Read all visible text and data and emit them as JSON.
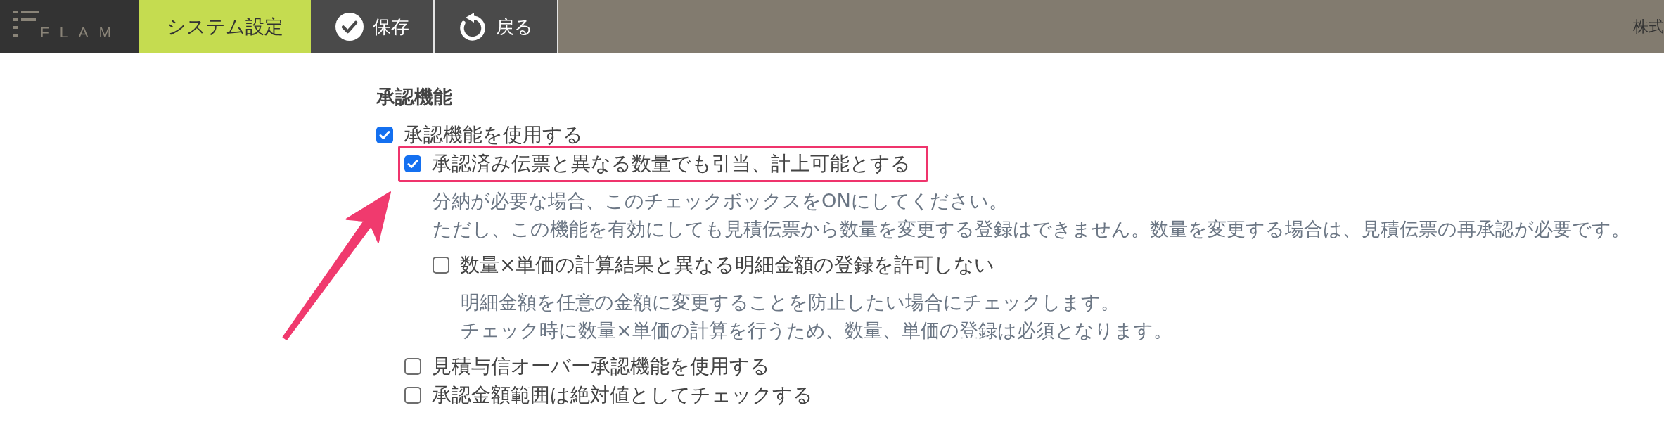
{
  "header": {
    "logo": "FLAM",
    "tabs": [
      {
        "label": "システム設定",
        "selected": true
      }
    ],
    "actions": [
      {
        "kind": "save",
        "label": "保存"
      },
      {
        "kind": "back",
        "label": "戻る"
      }
    ],
    "company": "株式"
  },
  "section": {
    "title": "承認機能",
    "options": [
      {
        "label": "承認機能を使用する",
        "checked": true,
        "children": [
          {
            "label": "承認済み伝票と異なる数量でも引当、計上可能とする",
            "checked": true,
            "highlighted": true,
            "notes": [
              "分納が必要な場合、このチェックボックスをONにしてください。",
              "ただし、この機能を有効にしても見積伝票から数量を変更する登録はできません。数量を変更する場合は、見積伝票の再承認が必要です。"
            ],
            "children": [
              {
                "label": "数量×単価の計算結果と異なる明細金額の登録を許可しない",
                "checked": false,
                "notes": [
                  "明細金額を任意の金額に変更することを防止したい場合にチェックします。",
                  "チェック時に数量×単価の計算を行うため、数量、単価の登録は必須となります。"
                ]
              }
            ]
          },
          {
            "label": "見積与信オーバー承認機能を使用する",
            "checked": false
          },
          {
            "label": "承認金額範囲は絶対値としてチェックする",
            "checked": false
          }
        ]
      }
    ]
  }
}
